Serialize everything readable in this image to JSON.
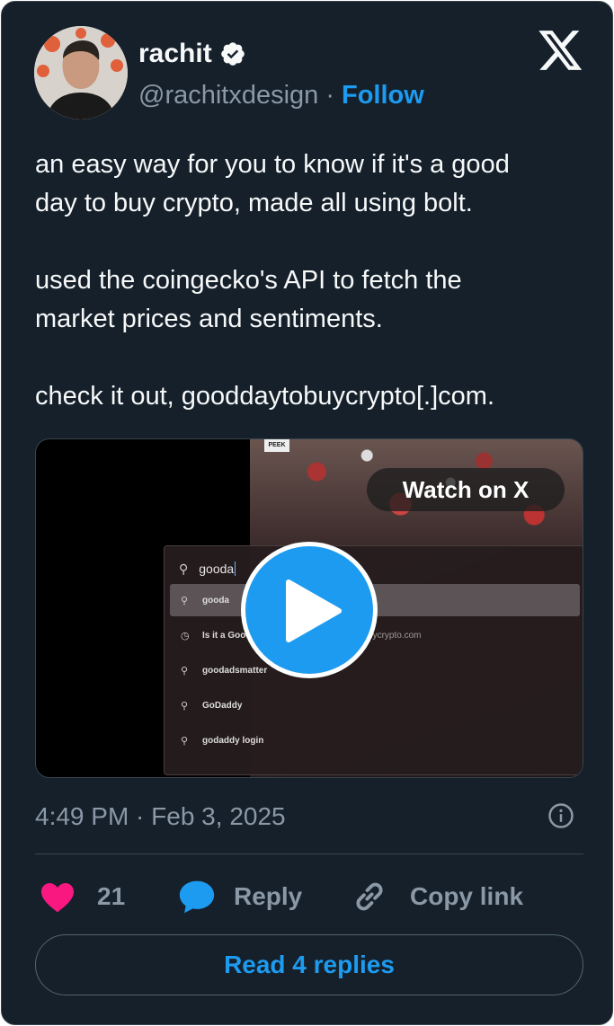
{
  "author": {
    "name": "rachit",
    "handle": "@rachitxdesign",
    "separator": "·",
    "follow_label": "Follow",
    "verified": true
  },
  "tweet": {
    "paragraphs": [
      "an easy way for you to know if it's a good\nday to buy crypto, made all using bolt.",
      "used the coingecko's API to fetch the\nmarket prices and sentiments.",
      "check it out, gooddaytobuycrypto[.]com."
    ]
  },
  "media": {
    "watch_label": "Watch on X",
    "peek_tag": "PEEK",
    "search_query": "gooda",
    "suggestions": [
      {
        "icon": "search-icon",
        "text": "gooda"
      },
      {
        "icon": "history-icon",
        "text": "Is it a Good",
        "url": "ddaytobuycrypto.com"
      },
      {
        "icon": "search-icon",
        "text": "goodadsmatter"
      },
      {
        "icon": "search-icon",
        "text": "GoDaddy"
      },
      {
        "icon": "search-icon",
        "text": "godaddy login"
      }
    ]
  },
  "timestamp": "4:49 PM · Feb 3, 2025",
  "actions": {
    "like_count": "21",
    "reply_label": "Reply",
    "copy_label": "Copy link"
  },
  "read_replies_label": "Read 4 replies",
  "colors": {
    "background": "#15202b",
    "accent": "#1d9bf0",
    "like": "#f91880",
    "muted": "#8b98a5"
  }
}
